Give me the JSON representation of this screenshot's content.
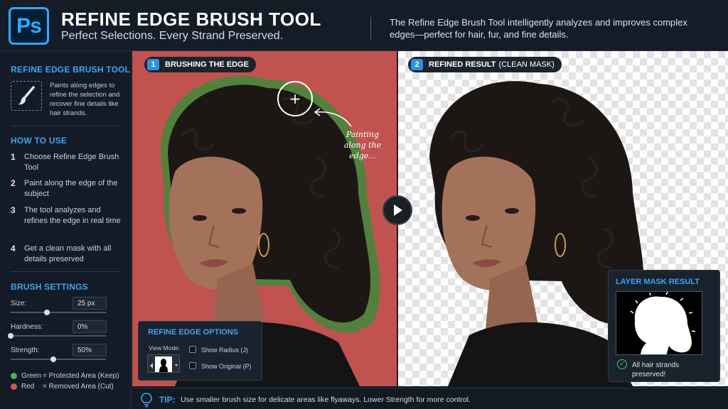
{
  "header": {
    "logo_text": "Ps",
    "title": "REFINE EDGE BRUSH TOOL",
    "subtitle": "Perfect Selections. Every Strand Preserved.",
    "description": "The Refine Edge Brush Tool intelligently analyzes and improves complex edges—perfect for hair, fur, and fine details."
  },
  "sidebar": {
    "tool_section": {
      "title": "REFINE EDGE BRUSH TOOL",
      "icon": "brush-icon",
      "description": "Paints along edges to refine the selection and recover fine details like hair strands."
    },
    "how_to_use": {
      "title": "HOW TO USE",
      "steps": [
        {
          "number": "1",
          "text": "Choose Refine Edge Brush Tool"
        },
        {
          "number": "2",
          "text": "Paint along the edge of the subject"
        },
        {
          "number": "3",
          "text": "The tool analyzes and refines the edge in real time"
        },
        {
          "number": "4",
          "text": "Get a clean mask with all details preserved"
        }
      ]
    },
    "brush_settings": {
      "title": "BRUSH SETTINGS",
      "size": {
        "label": "Size:",
        "value": "25 px",
        "slider_fraction": 0.38
      },
      "hardness": {
        "label": "Hardness:",
        "value": "0%",
        "slider_fraction": 0.0
      },
      "strength": {
        "label": "Strength:",
        "value": "50%",
        "slider_fraction": 0.45
      }
    },
    "legend": [
      {
        "name": "Green",
        "meaning": "= Protected Area (Keep)",
        "color": "#4cae5a"
      },
      {
        "name": "Red",
        "meaning": "= Removed Area (Cut)",
        "color": "#d9534f"
      }
    ]
  },
  "left_panel": {
    "number": "1",
    "label": "BRUSHING THE EDGE",
    "background_color": "#c0524f",
    "annotation": "Painting along the edge...",
    "cursor_icon": "plus-icon"
  },
  "right_panel": {
    "number": "2",
    "label": "REFINED RESULT",
    "label_suffix": "(CLEAN MASK)"
  },
  "play_button": {
    "icon": "play-icon"
  },
  "refine_edge_options": {
    "title": "REFINE EDGE OPTIONS",
    "view_mode_label": "View Mode:",
    "show_radius": {
      "label": "Show Radius (J)",
      "checked": false
    },
    "show_original": {
      "label": "Show Original (P)",
      "checked": false
    }
  },
  "layer_mask": {
    "title": "LAYER MASK RESULT",
    "caption": "All hair strands preserved!",
    "check_color": "#4cc36b"
  },
  "tip": {
    "icon": "lightbulb-icon",
    "label": "TIP:",
    "text": "Use smaller brush size for delicate areas like flyaways. Lower Strength for more control."
  },
  "accent_color": "#3aa6f0"
}
